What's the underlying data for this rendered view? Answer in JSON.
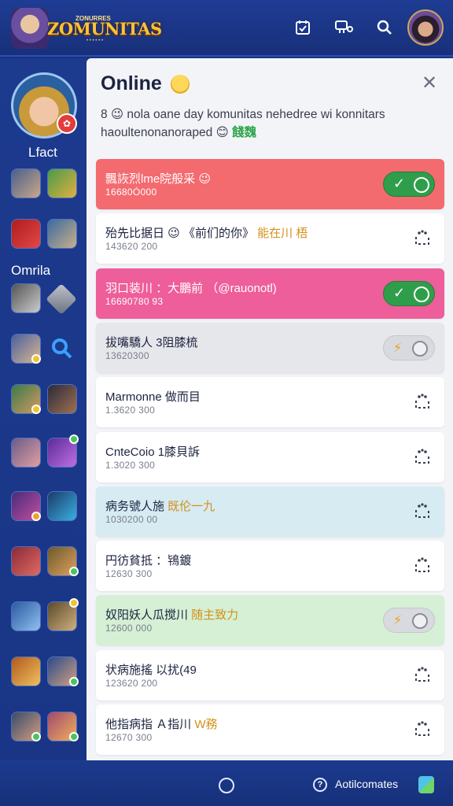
{
  "app": {
    "logo_text": "ZOMUNITAS",
    "logo_top": "ZONURRES"
  },
  "sidebar": {
    "label_top": "Lfact",
    "label_mid": "Omrila"
  },
  "panel": {
    "title": "Online",
    "description": "8 😉 nola oane day komunitas nehedree wi konnitars haoultenonanoraped 😊",
    "description_tag": "餞魏"
  },
  "rows": [
    {
      "name": "飄詼烈lme院般采 😉",
      "accent": "",
      "meta": "16680Ó000",
      "style": "red",
      "control": "toggle-on"
    },
    {
      "name": "殆先比据日 😉 《前们的你》 ",
      "accent": "能在川 梧",
      "meta": "143620 200",
      "style": "white",
      "control": "dots"
    },
    {
      "name": "羽口装川 ：大鵬前 （@rauonotl)",
      "accent": "",
      "meta": "16690780 93",
      "style": "pink",
      "control": "toggle-on"
    },
    {
      "name": "拔嘴驕人 3阻膝梳",
      "accent": "",
      "meta": "13620300",
      "style": "grey",
      "control": "toggle-grey"
    },
    {
      "name": "Marmonne 做而目",
      "accent": "",
      "meta": "1.3620 300",
      "style": "white",
      "control": "dots"
    },
    {
      "name": "CnteCoio 1膝貝訴",
      "accent": "",
      "meta": "1.3020 300",
      "style": "white",
      "control": "dots"
    },
    {
      "name": "病务號人施 ",
      "accent": "既伦一九",
      "meta": "1030200 00",
      "style": "blue",
      "control": "dots"
    },
    {
      "name": "円彷貧抵 ：鴇鍍",
      "accent": "",
      "meta": "12630 300",
      "style": "white",
      "control": "dots"
    },
    {
      "name": "奴阳妖人瓜搅川 ",
      "accent": "随主致力",
      "meta": "12600 000",
      "style": "green",
      "control": "toggle-grey"
    },
    {
      "name": "状病施搖 以扰(49",
      "accent": "",
      "meta": "123620 200",
      "style": "white",
      "control": "dots"
    },
    {
      "name": "他指病指 Ａ指川 ",
      "accent": "W務",
      "meta": "12670 300",
      "style": "white",
      "control": "dots"
    }
  ],
  "bottom": {
    "label": "Aotilcomates"
  }
}
